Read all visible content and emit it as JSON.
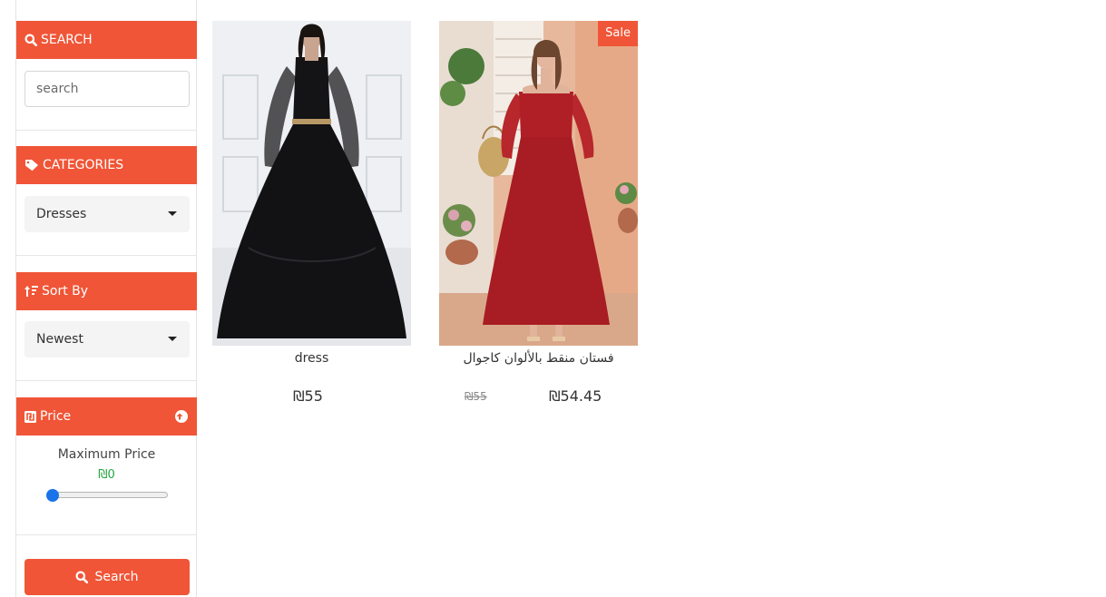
{
  "sidebar": {
    "search": {
      "title": "SEARCH",
      "placeholder": "search"
    },
    "categories": {
      "title": "CATEGORIES",
      "selected": "Dresses"
    },
    "sort": {
      "title": "Sort By",
      "selected": "Newest"
    },
    "price": {
      "title": "Price",
      "max_label": "Maximum Price",
      "max_value": "₪0",
      "slider_fraction": 0
    },
    "search_button": "Search"
  },
  "products": [
    {
      "name": "dress",
      "price": "₪55"
    },
    {
      "name": "فستان منقط بالألوان كاجوال",
      "price": "₪54.45",
      "old_price": "₪55",
      "badge": "Sale"
    }
  ],
  "colors": {
    "accent": "#f05537",
    "price_value": "#28a745",
    "slider_thumb": "#1a73e8"
  }
}
